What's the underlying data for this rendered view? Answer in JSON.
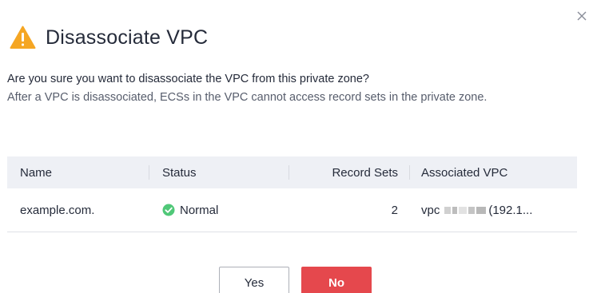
{
  "dialog": {
    "title": "Disassociate VPC",
    "close_icon": "close-icon",
    "warning_icon": "warning-triangle-icon",
    "warning_color": "#f5a623"
  },
  "message": {
    "line1": "Are you sure you want to disassociate the VPC from this private zone?",
    "line2": "After a VPC is disassociated, ECSs in the VPC cannot access record sets in the private zone."
  },
  "table": {
    "headers": {
      "name": "Name",
      "status": "Status",
      "record_sets": "Record Sets",
      "associated_vpc": "Associated VPC"
    },
    "rows": [
      {
        "name": "example.com.",
        "status": "Normal",
        "status_icon": "check-circle-icon",
        "status_color": "#50c878",
        "record_sets": "2",
        "vpc_prefix": "vpc",
        "vpc_suffix": "(192.1..."
      }
    ]
  },
  "buttons": {
    "yes": "Yes",
    "no": "No",
    "no_color": "#e5484d"
  }
}
